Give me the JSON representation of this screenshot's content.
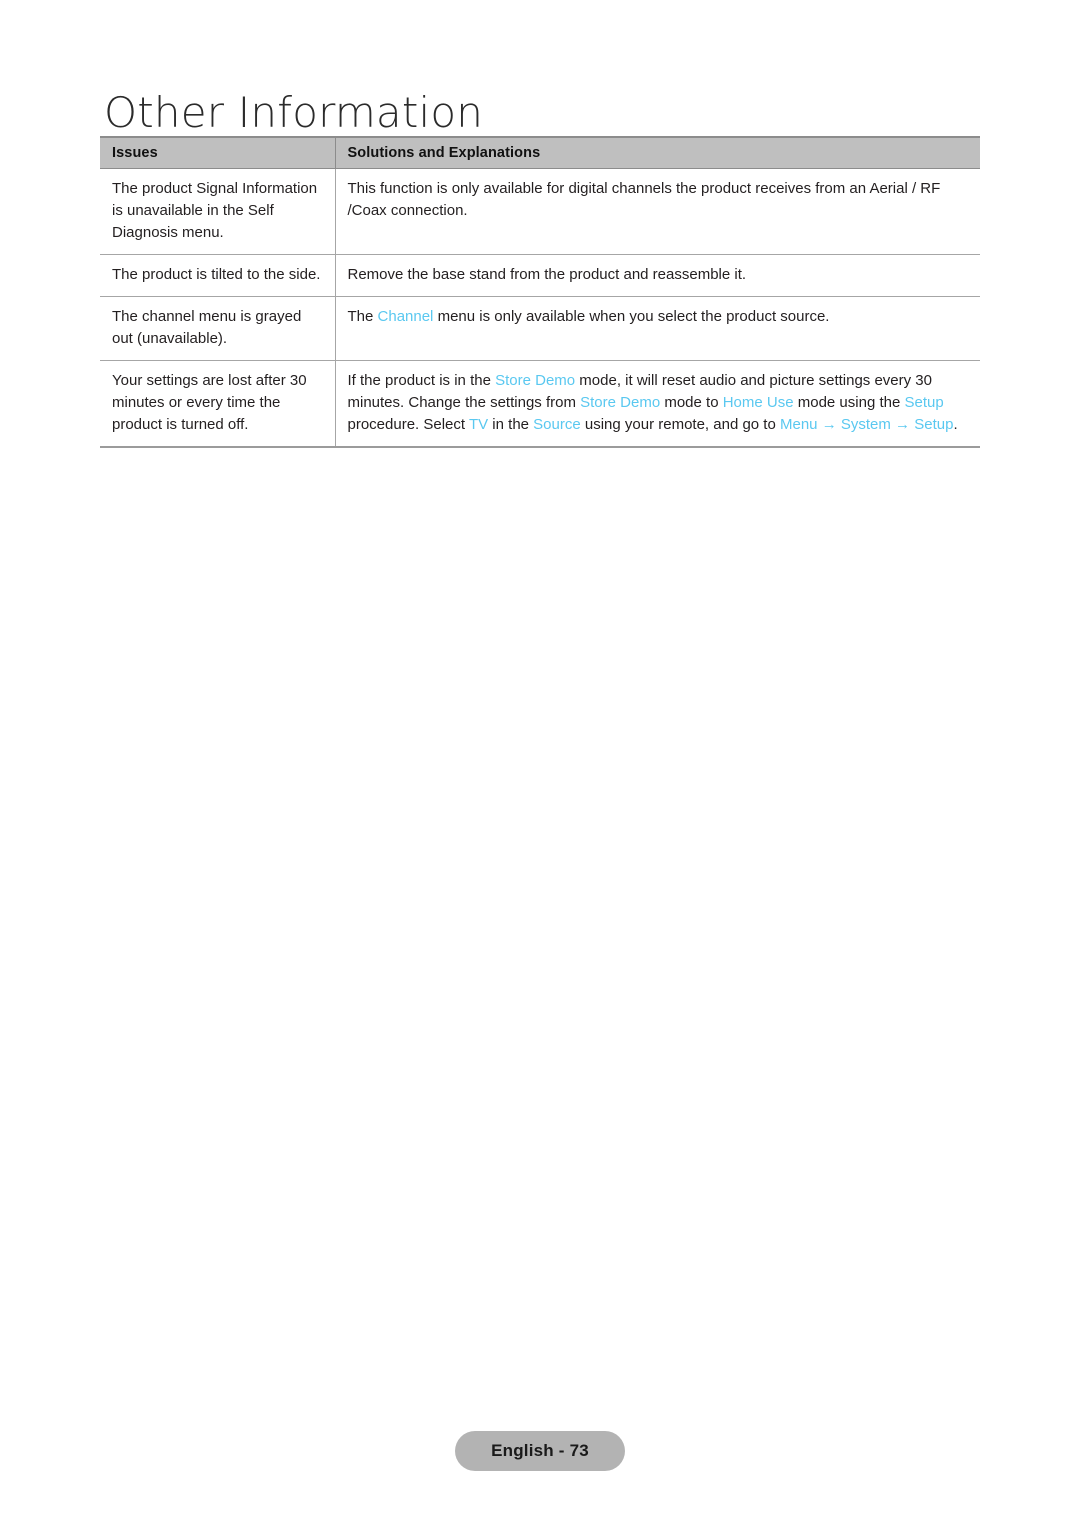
{
  "document": {
    "chapter_title": "Other Information",
    "footer_label": "English - 73",
    "accent_color": "#5ac8f0",
    "header_bg_color": "#bfbfbf",
    "badge_bg_color": "#b3b3b3"
  },
  "table": {
    "headers": {
      "issues": "Issues",
      "solutions": "Solutions and Explanations"
    },
    "rows": [
      {
        "issue": "The product Signal Information is unavailable in the Self Diagnosis menu.",
        "solution_parts": [
          {
            "text": "This function is only available for digital channels the product receives from an Aerial / RF /Coax connection.",
            "highlight": false
          }
        ]
      },
      {
        "issue": "The product is tilted to the side.",
        "solution_parts": [
          {
            "text": "Remove the base stand from the product and reassemble it.",
            "highlight": false
          }
        ]
      },
      {
        "issue": "The channel menu is grayed out (unavailable).",
        "solution_parts": [
          {
            "text": "The ",
            "highlight": false
          },
          {
            "text": "Channel",
            "highlight": true
          },
          {
            "text": " menu is only available when you select the product source.",
            "highlight": false
          }
        ]
      },
      {
        "issue": "Your settings are lost after 30 minutes or every time the product is turned off.",
        "solution_parts": [
          {
            "text": "If the product is in the ",
            "highlight": false
          },
          {
            "text": "Store Demo",
            "highlight": true
          },
          {
            "text": " mode, it will reset audio and picture settings every 30 minutes. Change the settings from ",
            "highlight": false
          },
          {
            "text": "Store Demo",
            "highlight": true
          },
          {
            "text": " mode to ",
            "highlight": false
          },
          {
            "text": "Home Use",
            "highlight": true
          },
          {
            "text": " mode using the ",
            "highlight": false
          },
          {
            "text": "Setup",
            "highlight": true
          },
          {
            "text": " procedure. Select ",
            "highlight": false
          },
          {
            "text": "TV",
            "highlight": true
          },
          {
            "text": " in the ",
            "highlight": false
          },
          {
            "text": "Source",
            "highlight": true
          },
          {
            "text": " using your remote, and go to ",
            "highlight": false
          },
          {
            "text": "Menu",
            "highlight": true
          },
          {
            "text": " → ",
            "highlight": true
          },
          {
            "text": "System",
            "highlight": true
          },
          {
            "text": " → ",
            "highlight": true
          },
          {
            "text": "Setup",
            "highlight": true
          },
          {
            "text": ".",
            "highlight": false
          }
        ]
      }
    ]
  }
}
